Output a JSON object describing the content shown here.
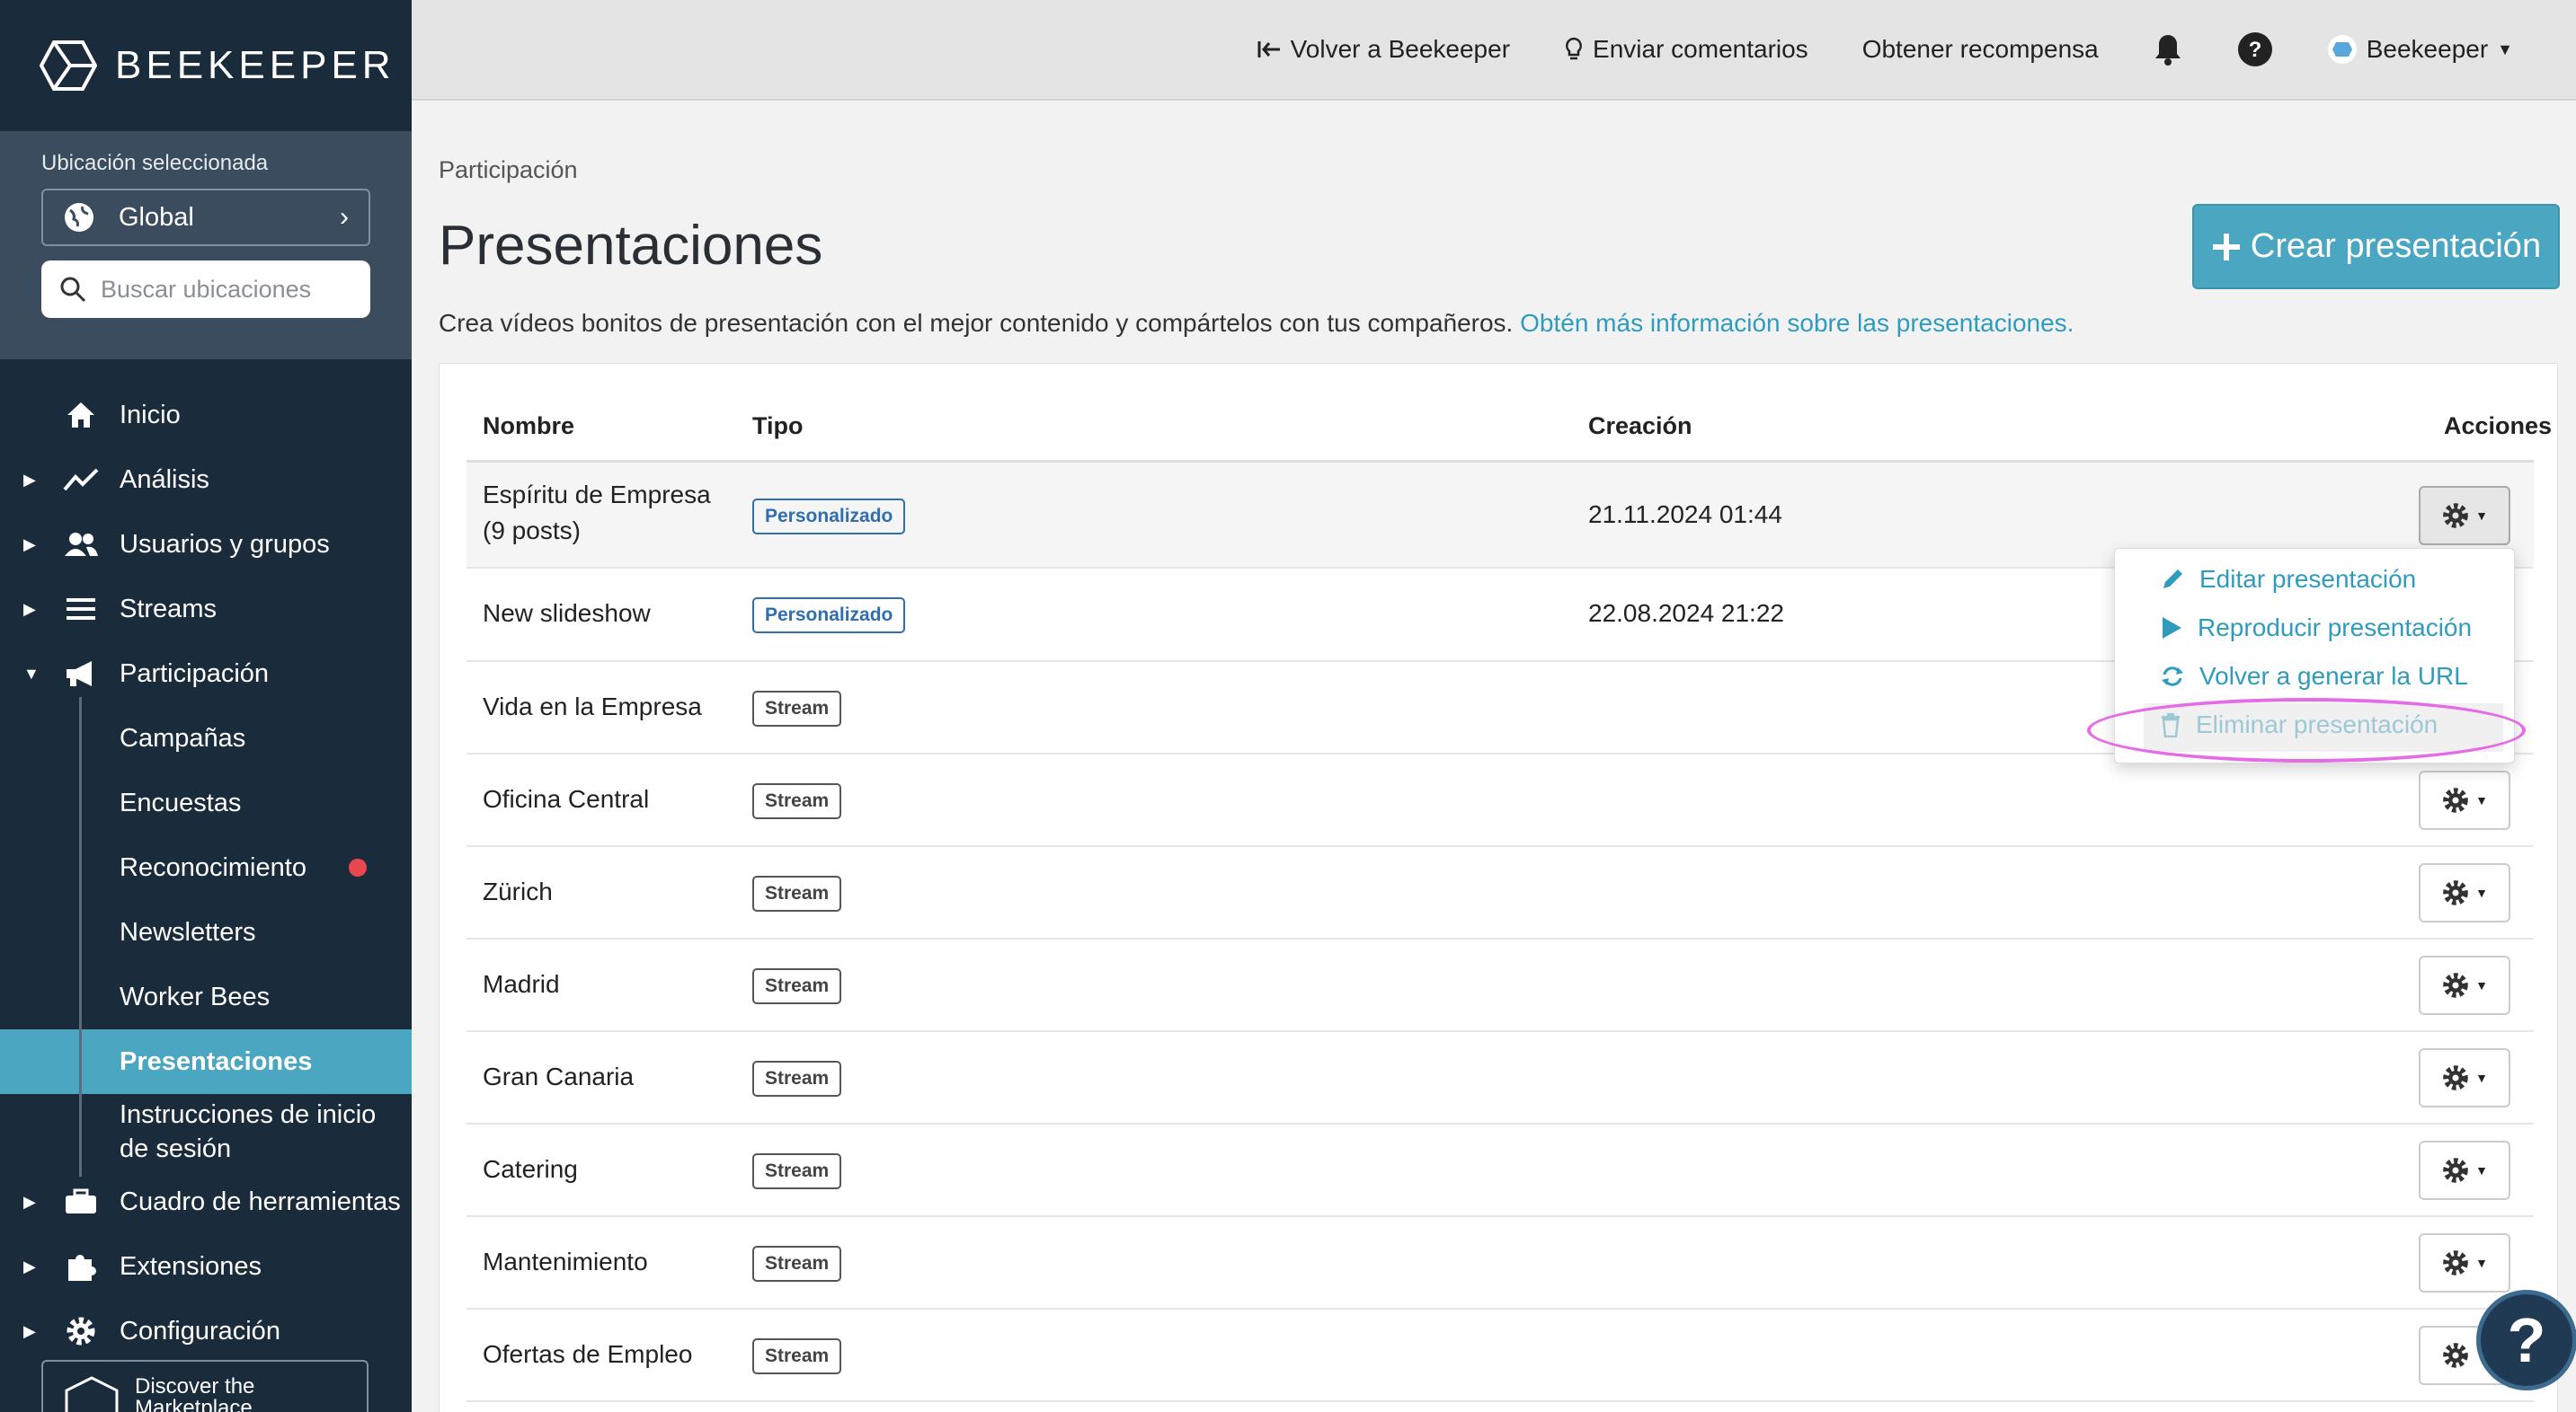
{
  "sidebar": {
    "brand": "BEEKEEPER",
    "location_label": "Ubicación seleccionada",
    "location_value": "Global",
    "search_placeholder": "Buscar ubicaciones",
    "nav": [
      {
        "label": "Inicio",
        "icon": "home-icon"
      },
      {
        "label": "Análisis",
        "icon": "chart-line-icon"
      },
      {
        "label": "Usuarios y grupos",
        "icon": "users-icon"
      },
      {
        "label": "Streams",
        "icon": "list-icon"
      },
      {
        "label": "Participación",
        "icon": "megaphone-icon"
      }
    ],
    "sub_items": [
      "Campañas",
      "Encuestas",
      "Reconocimiento",
      "Newsletters",
      "Worker Bees",
      "Presentaciones",
      "Instrucciones de inicio de sesión"
    ],
    "nav_bottom": [
      {
        "label": "Cuadro de herramientas",
        "icon": "toolbox-icon"
      },
      {
        "label": "Extensiones",
        "icon": "puzzle-icon"
      },
      {
        "label": "Configuración",
        "icon": "gear-icon"
      }
    ],
    "marketplace": "Discover the Marketplace"
  },
  "topbar": {
    "back": "Volver a Beekeeper",
    "feedback": "Enviar comentarios",
    "reward": "Obtener recompensa",
    "user": "Beekeeper"
  },
  "main": {
    "breadcrumb": "Participación",
    "title": "Presentaciones",
    "create_button": "Crear presentación",
    "description": "Crea vídeos bonitos de presentación con el mejor contenido y compártelos con tus compañeros.",
    "learn_more": "Obtén más información sobre las presentaciones.",
    "columns": [
      "Nombre",
      "Tipo",
      "Creación",
      "Acciones"
    ],
    "rows": [
      {
        "name": "Espíritu de Empresa",
        "name2": "(9 posts)",
        "type": "Personalizado",
        "date": "21.11.2024 01:44"
      },
      {
        "name": "New slideshow",
        "type": "Personalizado",
        "date": "22.08.2024 21:22"
      },
      {
        "name": "Vida en la Empresa",
        "type": "Stream",
        "date": ""
      },
      {
        "name": "Oficina Central",
        "type": "Stream",
        "date": ""
      },
      {
        "name": "Zürich",
        "type": "Stream",
        "date": ""
      },
      {
        "name": "Madrid",
        "type": "Stream",
        "date": ""
      },
      {
        "name": "Gran Canaria",
        "type": "Stream",
        "date": ""
      },
      {
        "name": "Catering",
        "type": "Stream",
        "date": ""
      },
      {
        "name": "Mantenimiento",
        "type": "Stream",
        "date": ""
      },
      {
        "name": "Ofertas de Empleo",
        "type": "Stream",
        "date": ""
      }
    ],
    "menu": [
      "Editar presentación",
      "Reproducir presentación",
      "Volver a generar la URL",
      "Eliminar presentación"
    ]
  },
  "colors": {
    "sidebar": "#1a2b3b",
    "accent": "#4aa6c1",
    "link": "#2f9bbd",
    "highlight_ring": "#e66be6",
    "notification_dot": "#e8474f"
  }
}
